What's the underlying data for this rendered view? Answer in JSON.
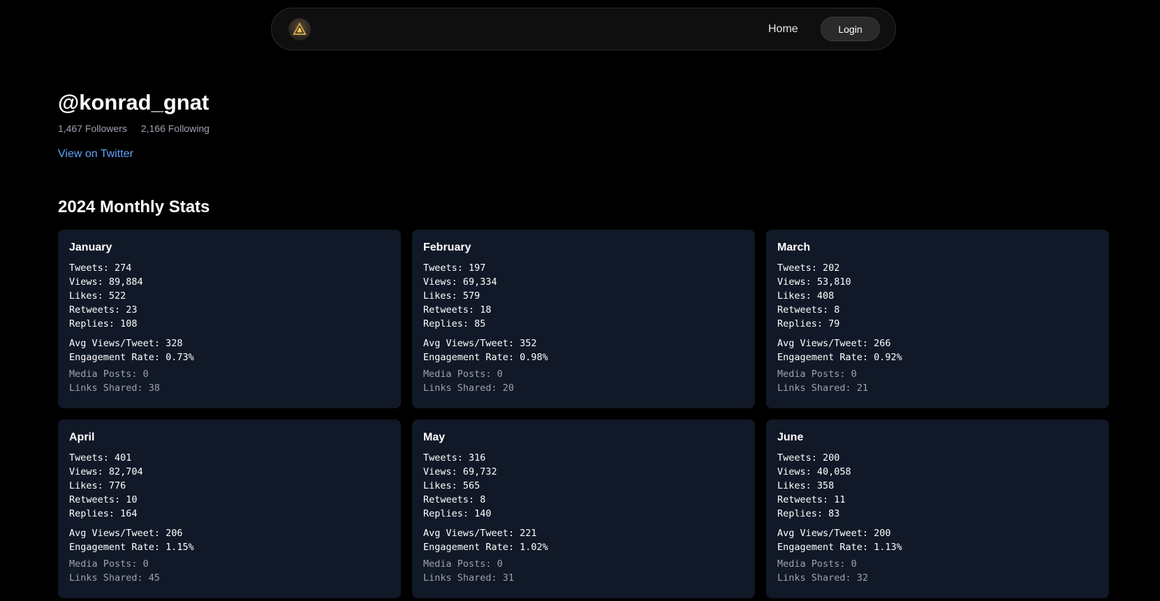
{
  "nav": {
    "logo_icon": "pyramid-logo-icon",
    "home_label": "Home",
    "login_label": "Login"
  },
  "profile": {
    "handle": "@konrad_gnat",
    "followers": "1,467 Followers",
    "following": "2,166 Following",
    "twitter_link": "View on Twitter"
  },
  "section": {
    "title": "2024 Monthly Stats"
  },
  "months": [
    {
      "name": "January",
      "tweets": "Tweets: 274",
      "views": "Views: 89,884",
      "likes": "Likes: 522",
      "retweets": "Retweets: 23",
      "replies": "Replies: 108",
      "avg_views": "Avg Views/Tweet: 328",
      "engagement": "Engagement Rate: 0.73%",
      "media": "Media Posts: 0",
      "links": "Links Shared: 38"
    },
    {
      "name": "February",
      "tweets": "Tweets: 197",
      "views": "Views: 69,334",
      "likes": "Likes: 579",
      "retweets": "Retweets: 18",
      "replies": "Replies: 85",
      "avg_views": "Avg Views/Tweet: 352",
      "engagement": "Engagement Rate: 0.98%",
      "media": "Media Posts: 0",
      "links": "Links Shared: 20"
    },
    {
      "name": "March",
      "tweets": "Tweets: 202",
      "views": "Views: 53,810",
      "likes": "Likes: 408",
      "retweets": "Retweets: 8",
      "replies": "Replies: 79",
      "avg_views": "Avg Views/Tweet: 266",
      "engagement": "Engagement Rate: 0.92%",
      "media": "Media Posts: 0",
      "links": "Links Shared: 21"
    },
    {
      "name": "April",
      "tweets": "Tweets: 401",
      "views": "Views: 82,704",
      "likes": "Likes: 776",
      "retweets": "Retweets: 10",
      "replies": "Replies: 164",
      "avg_views": "Avg Views/Tweet: 206",
      "engagement": "Engagement Rate: 1.15%",
      "media": "Media Posts: 0",
      "links": "Links Shared: 45"
    },
    {
      "name": "May",
      "tweets": "Tweets: 316",
      "views": "Views: 69,732",
      "likes": "Likes: 565",
      "retweets": "Retweets: 8",
      "replies": "Replies: 140",
      "avg_views": "Avg Views/Tweet: 221",
      "engagement": "Engagement Rate: 1.02%",
      "media": "Media Posts: 0",
      "links": "Links Shared: 31"
    },
    {
      "name": "June",
      "tweets": "Tweets: 200",
      "views": "Views: 40,058",
      "likes": "Likes: 358",
      "retweets": "Retweets: 11",
      "replies": "Replies: 83",
      "avg_views": "Avg Views/Tweet: 200",
      "engagement": "Engagement Rate: 1.13%",
      "media": "Media Posts: 0",
      "links": "Links Shared: 32"
    }
  ],
  "colors": {
    "background": "#000000",
    "card_bg": "#111827",
    "link": "#60a5fa",
    "muted_text": "#9ca3af"
  }
}
